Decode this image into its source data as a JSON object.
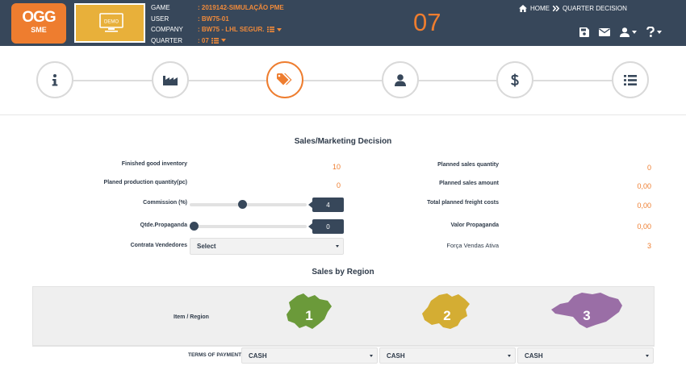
{
  "header": {
    "logo_main": "OGG",
    "logo_sub": "SME",
    "demo_label": "DEMO",
    "info": [
      {
        "key": "GAME",
        "value": ": 2019142-SIMULAÇÃO PME"
      },
      {
        "key": "USER",
        "value": ": BW75-01"
      },
      {
        "key": "COMPANY",
        "value": ": BW75 - LHL SEGUR."
      },
      {
        "key": "QUARTER",
        "value": ": 07"
      }
    ],
    "quarter_number": "07",
    "breadcrumb_home": "HOME",
    "breadcrumb_current": "QUARTER DECISION"
  },
  "colors": {
    "accent": "#ee7d2f",
    "navy": "#37475a",
    "region1": "#6b9a3a",
    "region2": "#d4ad33",
    "region3": "#9a6ea6"
  },
  "stepper": [
    "info-icon",
    "factory-icon",
    "price-tag-icon",
    "user-icon",
    "dollar-icon",
    "list-icon"
  ],
  "sales": {
    "title": "Sales/Marketing Decision",
    "left": {
      "finished_label": "Finished good inventory",
      "finished_value": "10",
      "planned_prod_label": "Planed production quantity(pc)",
      "planned_prod_value": "0",
      "commission_label": "Commission (%)",
      "commission_value": "4",
      "propaganda_label": "Qtde.Propaganda",
      "propaganda_value": "0",
      "contrata_label": "Contrata Vendedores",
      "contrata_select": "Select"
    },
    "right": {
      "planned_qty_label": "Planned sales quantity",
      "planned_qty_value": "0",
      "planned_amt_label": "Planned sales amount",
      "planned_amt_value": "0,00",
      "freight_label": "Total planned freight costs",
      "freight_value": "0,00",
      "propaganda_label": "Valor Propaganda",
      "propaganda_value": "0,00",
      "forca_label": "Força Vendas Ativa",
      "forca_value": "3"
    }
  },
  "regions": {
    "title": "Sales by Region",
    "item_label": "Item / Region",
    "numbers": [
      "1",
      "2",
      "3"
    ],
    "terms_label": "TERMS OF PAYMENT",
    "terms_values": [
      "CASH",
      "CASH",
      "CASH"
    ]
  }
}
